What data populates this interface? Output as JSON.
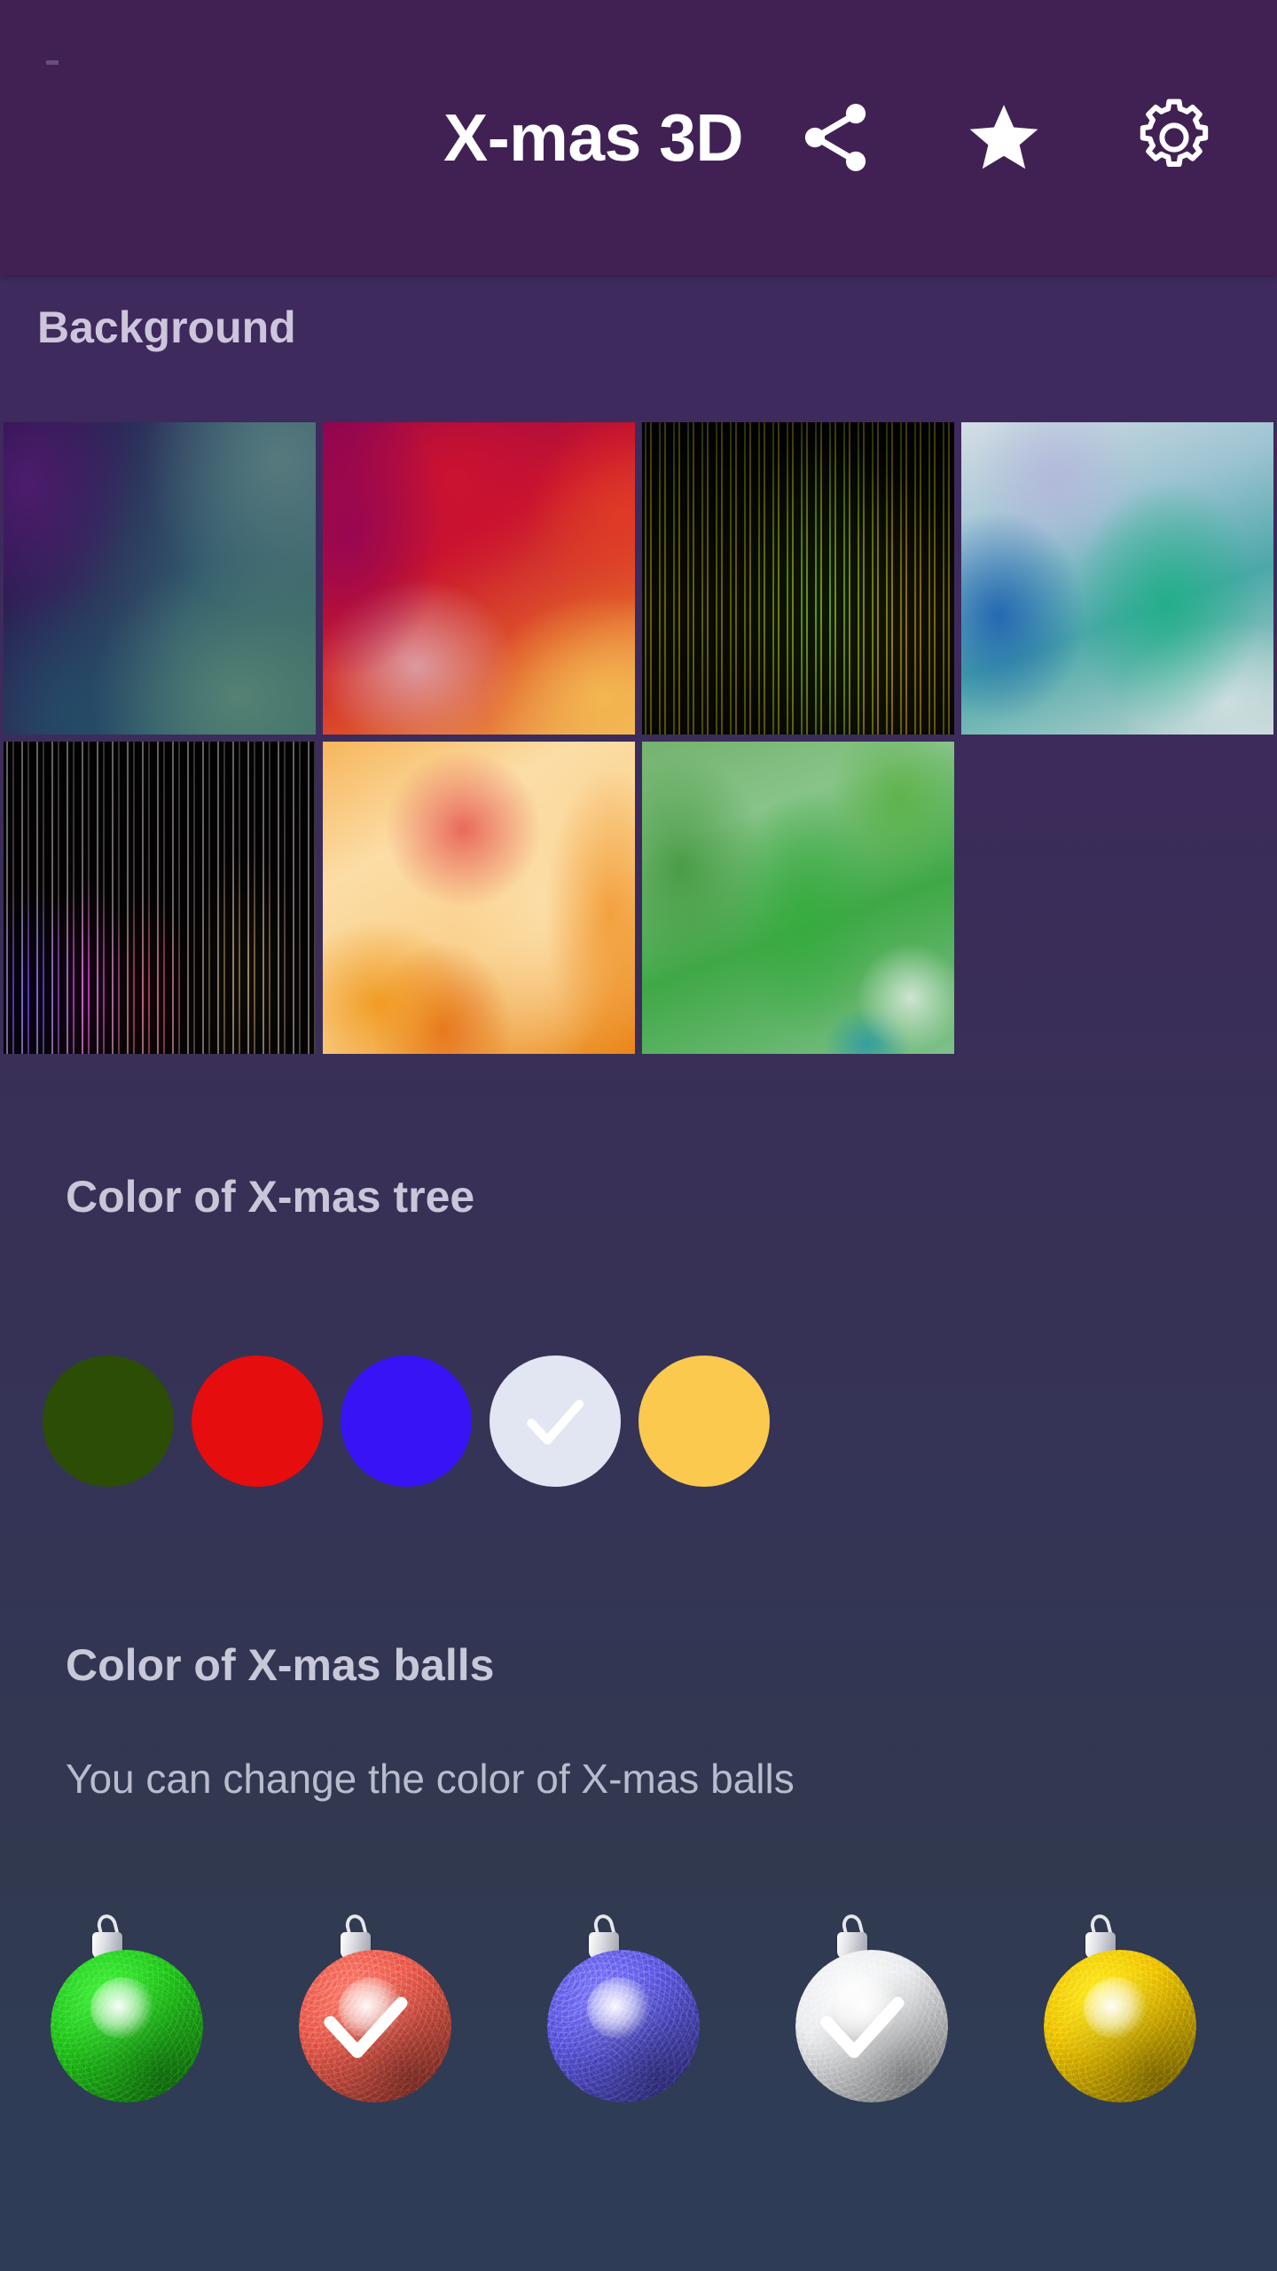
{
  "app": {
    "title": "X-mas 3D",
    "bar_color": "#412154",
    "page_gradient_top": "#3e2a5c",
    "page_gradient_bottom": "#2f3c57",
    "actions": [
      {
        "name": "share-icon",
        "label": "Share"
      },
      {
        "name": "star-icon",
        "label": "Rate"
      },
      {
        "name": "gear-icon",
        "label": "Settings"
      }
    ]
  },
  "background_section": {
    "title": "Background",
    "thumbnails": [
      {
        "name": "background-thumb-1",
        "description": "purple to teal blur"
      },
      {
        "name": "background-thumb-2",
        "description": "crimson magenta orange blur"
      },
      {
        "name": "background-thumb-3",
        "description": "dark olive green light streaks"
      },
      {
        "name": "background-thumb-4",
        "description": "pale blue teal green blur"
      },
      {
        "name": "background-thumb-5",
        "description": "dark violet magenta light streaks"
      },
      {
        "name": "background-thumb-6",
        "description": "cream orange yellow blur"
      },
      {
        "name": "background-thumb-7",
        "description": "green blur"
      }
    ]
  },
  "tree_section": {
    "title": "Color of X-mas tree",
    "swatches": [
      {
        "name": "tree-color-green",
        "label": "Green",
        "color": "#2b4d06",
        "selected": false
      },
      {
        "name": "tree-color-red",
        "label": "Red",
        "color": "#e50d0d",
        "selected": false
      },
      {
        "name": "tree-color-blue",
        "label": "Blue",
        "color": "#3713f5",
        "selected": false
      },
      {
        "name": "tree-color-white",
        "label": "White",
        "color": "#e2e6f2",
        "selected": true
      },
      {
        "name": "tree-color-yellow",
        "label": "Yellow",
        "color": "#fbc94e",
        "selected": false
      }
    ]
  },
  "balls_section": {
    "title": "Color of X-mas balls",
    "subtitle": "You can change the color of X-mas balls",
    "balls": [
      {
        "name": "ball-color-green",
        "label": "Green",
        "color": "#25c61f",
        "selected": false
      },
      {
        "name": "ball-color-red",
        "label": "Red",
        "color": "#e8574a",
        "selected": true
      },
      {
        "name": "ball-color-blue",
        "label": "Blue",
        "color": "#5a56df",
        "selected": false
      },
      {
        "name": "ball-color-silver",
        "label": "Silver",
        "color": "#e9ebee",
        "selected": true
      },
      {
        "name": "ball-color-gold",
        "label": "Gold",
        "color": "#eec007",
        "selected": false
      }
    ]
  }
}
